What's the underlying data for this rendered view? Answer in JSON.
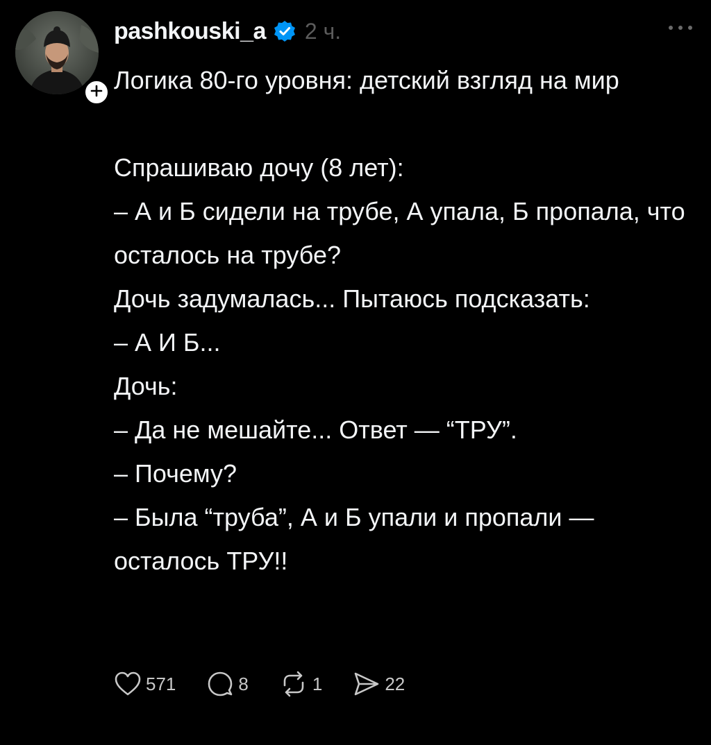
{
  "post": {
    "username": "pashkouski_a",
    "time": "2 ч.",
    "text": "Логика 80-го уровня: детский взгляд на мир\n\nСпрашиваю дочу (8 лет):\n– А и Б сидели на трубе, А упала, Б пропала, что осталось на трубе?\nДочь задумалась... Пытаюсь подсказать:\n– А И Б...\nДочь:\n– Да не мешайте... Ответ — “ТРУ”.\n– Почему?\n– Была “труба”, А и Б упали и пропали — осталось ТРУ!!"
  },
  "actions": {
    "likes": "571",
    "replies": "8",
    "reposts": "1",
    "shares": "22"
  },
  "icons": {
    "verified": "verified-badge-icon",
    "follow": "plus-icon",
    "more": "ellipsis-icon",
    "like": "heart-icon",
    "reply": "speech-bubble-icon",
    "repost": "repost-arrows-icon",
    "share": "paper-plane-icon"
  },
  "colors": {
    "background": "#000000",
    "text": "#f3f5f7",
    "muted": "#5c5c5c",
    "verified_blue": "#0095f6"
  }
}
